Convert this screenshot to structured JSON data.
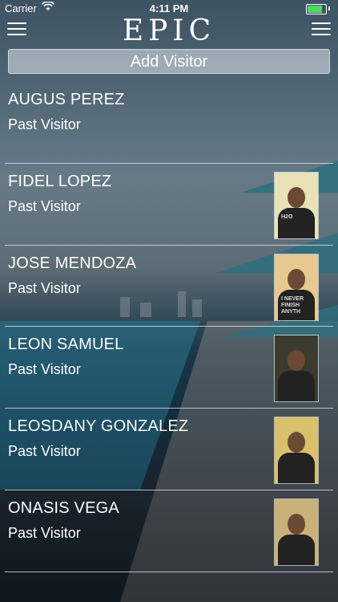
{
  "status_bar": {
    "carrier": "Carrier",
    "time": "4:11 PM",
    "battery_level": 0.9,
    "battery_color": "#4cd964"
  },
  "nav": {
    "logo": "EPIC"
  },
  "add_visitor_label": "Add Visitor",
  "visitors": [
    {
      "name": "AUGUS PEREZ",
      "status": "Past Visitor",
      "has_photo": false
    },
    {
      "name": "FIDEL LOPEZ",
      "status": "Past Visitor",
      "has_photo": true,
      "shirt_text": "H2O"
    },
    {
      "name": "JOSE MENDOZA",
      "status": "Past Visitor",
      "has_photo": true,
      "shirt_text": "I NEVER FINISH ANYTH"
    },
    {
      "name": "LEON SAMUEL",
      "status": "Past Visitor",
      "has_photo": true,
      "shirt_text": ""
    },
    {
      "name": "LEOSDANY GONZALEZ",
      "status": "Past Visitor",
      "has_photo": true,
      "shirt_text": ""
    },
    {
      "name": "ONASIS VEGA",
      "status": "Past Visitor",
      "has_photo": true,
      "shirt_text": ""
    }
  ]
}
